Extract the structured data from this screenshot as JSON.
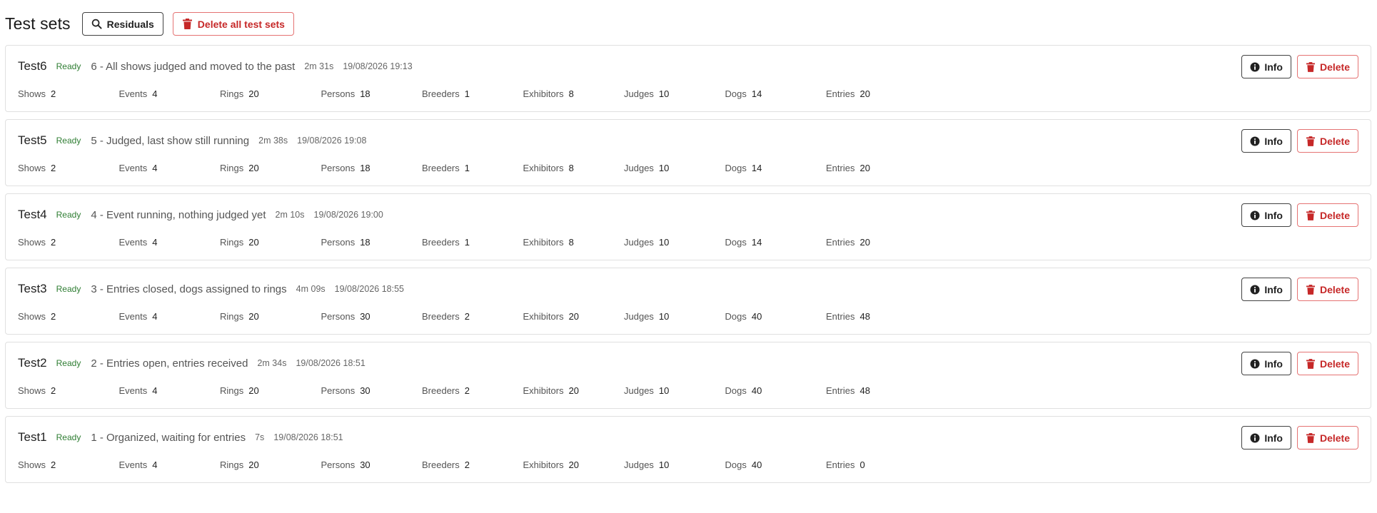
{
  "header": {
    "title": "Test sets",
    "residuals_label": "Residuals",
    "delete_all_label": "Delete all test sets"
  },
  "colors": {
    "ready_status": "#2e7d32",
    "danger": "#c62828",
    "border": "#e0e0e0"
  },
  "icons": {
    "residuals": "search-icon",
    "delete_all": "trash-icon",
    "info": "info-circle-icon",
    "delete": "trash-icon"
  },
  "stat_labels": [
    "Shows",
    "Events",
    "Rings",
    "Persons",
    "Breeders",
    "Exhibitors",
    "Judges",
    "Dogs",
    "Entries"
  ],
  "test_sets": [
    {
      "name": "Test6",
      "status": "Ready",
      "description": "6 - All shows judged and moved to the past",
      "duration": "2m 31s",
      "date": "19/08/2026 19:13",
      "info_label": "Info",
      "delete_label": "Delete",
      "stats": [
        "2",
        "4",
        "20",
        "18",
        "1",
        "8",
        "10",
        "14",
        "20"
      ]
    },
    {
      "name": "Test5",
      "status": "Ready",
      "description": "5 - Judged, last show still running",
      "duration": "2m 38s",
      "date": "19/08/2026 19:08",
      "info_label": "Info",
      "delete_label": "Delete",
      "stats": [
        "2",
        "4",
        "20",
        "18",
        "1",
        "8",
        "10",
        "14",
        "20"
      ]
    },
    {
      "name": "Test4",
      "status": "Ready",
      "description": "4 - Event running, nothing judged yet",
      "duration": "2m 10s",
      "date": "19/08/2026 19:00",
      "info_label": "Info",
      "delete_label": "Delete",
      "stats": [
        "2",
        "4",
        "20",
        "18",
        "1",
        "8",
        "10",
        "14",
        "20"
      ]
    },
    {
      "name": "Test3",
      "status": "Ready",
      "description": "3 - Entries closed, dogs assigned to rings",
      "duration": "4m 09s",
      "date": "19/08/2026 18:55",
      "info_label": "Info",
      "delete_label": "Delete",
      "stats": [
        "2",
        "4",
        "20",
        "30",
        "2",
        "20",
        "10",
        "40",
        "48"
      ]
    },
    {
      "name": "Test2",
      "status": "Ready",
      "description": "2 - Entries open, entries received",
      "duration": "2m 34s",
      "date": "19/08/2026 18:51",
      "info_label": "Info",
      "delete_label": "Delete",
      "stats": [
        "2",
        "4",
        "20",
        "30",
        "2",
        "20",
        "10",
        "40",
        "48"
      ]
    },
    {
      "name": "Test1",
      "status": "Ready",
      "description": "1 - Organized, waiting for entries",
      "duration": "7s",
      "date": "19/08/2026 18:51",
      "info_label": "Info",
      "delete_label": "Delete",
      "stats": [
        "2",
        "4",
        "20",
        "30",
        "2",
        "20",
        "10",
        "40",
        "0"
      ]
    }
  ]
}
